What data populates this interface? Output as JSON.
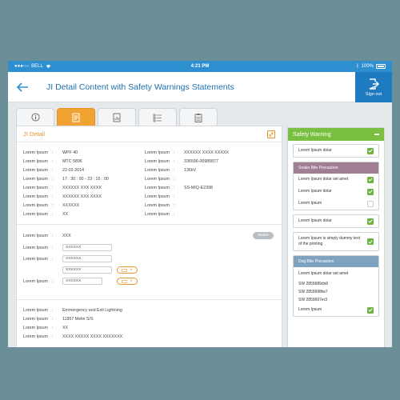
{
  "statusbar": {
    "carrier": "BELL",
    "time": "4:21 PM",
    "battery": "100%"
  },
  "header": {
    "title": "JI Detail Content with Safety Warnings Statements",
    "signout_label": "Sign out"
  },
  "tabs": [
    {
      "icon": "info-icon"
    },
    {
      "icon": "document-icon",
      "active": true
    },
    {
      "icon": "chart-document-icon"
    },
    {
      "icon": "checklist-icon"
    },
    {
      "icon": "clipboard-icon"
    }
  ],
  "detail": {
    "title": "JI Detail",
    "left_rows": [
      {
        "label": "Lorem Ipsum",
        "value": "WPF 40"
      },
      {
        "label": "Lorem Ipsum",
        "value": "MTC 5896"
      },
      {
        "label": "Lorem Ipsum",
        "value": "22-02-2014"
      },
      {
        "label": "Lorem Ipsum",
        "value": "17 : 30 : 00   -   23 : 15 : 00"
      },
      {
        "label": "Lorem Ipsum",
        "value": "XXXXXX XXX XXXX"
      },
      {
        "label": "Lorem Ipsum",
        "value": "XXXXXX XXX XXXX"
      },
      {
        "label": "Lorem Ipsum",
        "value": "XXXXXX"
      },
      {
        "label": "Lorem Ipsum",
        "value": "XX"
      }
    ],
    "right_rows": [
      {
        "label": "Lorem Ipsum",
        "value": "XXXXXX XXXX XXXXX"
      },
      {
        "label": "Lorem Ipsum",
        "value": "336596-00985877"
      },
      {
        "label": "Lorem Ipsum",
        "value": "136kV"
      },
      {
        "label": "Lorem Ipsum",
        "value": ""
      },
      {
        "label": "Lorem Ipsum",
        "value": "SS-MIQ-E2398"
      },
      {
        "label": "Lorem Ipsum",
        "value": ""
      },
      {
        "label": "Lorem Ipsum",
        "value": ""
      },
      {
        "label": "Lorem Ipsum",
        "value": ""
      }
    ],
    "form": {
      "reset_label": "Reset",
      "rows": [
        {
          "label": "Lorem Ipsum",
          "value": "XXX"
        },
        {
          "label": "Lorem Ipsum",
          "input": "XXXXXX"
        },
        {
          "label": "Lorem Ipsum",
          "input": "XXXXXX"
        },
        {
          "label": "",
          "input": "XXXXXX"
        },
        {
          "label": "Lorem Ipsum",
          "input": "XXXXXX"
        }
      ]
    },
    "bottom_rows": [
      {
        "label": "Lorem Ipsum",
        "value": "Emmergency and Exit Lightning"
      },
      {
        "label": "Lorem Ipsum",
        "value": "11857 Melin S/S"
      },
      {
        "label": "Lorem Ipsum",
        "value": "XX"
      },
      {
        "label": "Lorem Ipsum",
        "value": "XXXX XXXXX XXXX XXXXXXX"
      }
    ]
  },
  "safety": {
    "title": "Safety Warning",
    "item1": "Lorem Ipsum dolar",
    "snake": {
      "title": "Snake Bite Precaution",
      "color": "#a07f93",
      "items": [
        {
          "text": "Lorem Ipsum dolar set amet",
          "checked": true
        },
        {
          "text": "Lorem Ipsum dolar",
          "checked": true
        },
        {
          "text": "Lorem Ipsum",
          "checked": false
        }
      ]
    },
    "item2": "Lorem Ipsum dolar",
    "item3": "Lorem Ipsum is simply dummy text of the printing",
    "dog": {
      "title": "Dog Bite Precaution",
      "color": "#7fa3bf",
      "intro": "Lorem Ipsum dolar set amet",
      "codes": [
        "SW 2859689dx8",
        "SW 2859698tw7",
        "SW 2859697er3"
      ],
      "last": "Lorem Ipsum"
    }
  },
  "colors": {
    "accent": "#2e8fd0",
    "orange": "#f0a233",
    "green": "#7bbf42"
  }
}
